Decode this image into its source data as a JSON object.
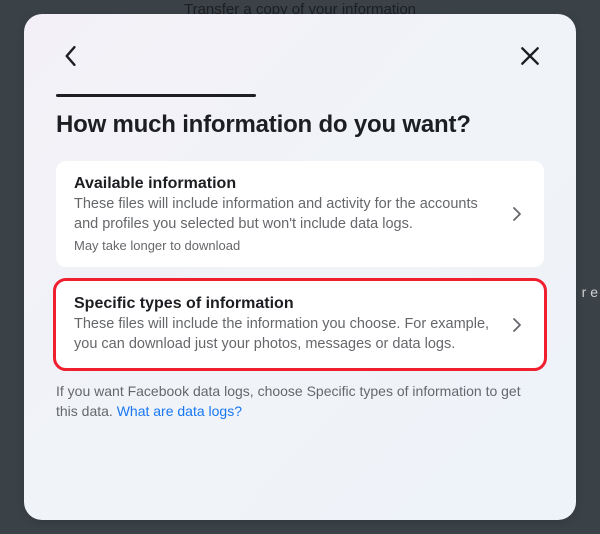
{
  "backdrop": {
    "title": "Transfer a copy of your information"
  },
  "modal": {
    "title": "How much information do you want?",
    "options": [
      {
        "title": "Available information",
        "description": "These files will include information and activity for the accounts and profiles you selected but won't include data logs.",
        "note": "May take longer to download"
      },
      {
        "title": "Specific types of information",
        "description": "These files will include the information you choose. For example, you can download just your photos, messages or data logs."
      }
    ],
    "footer": {
      "text_start": "If you want Facebook data logs, choose Specific types of information to get this data. ",
      "link_text": "What are data logs?"
    }
  },
  "side_fragment": "r e",
  "highlight_color": "#ef1f2f"
}
